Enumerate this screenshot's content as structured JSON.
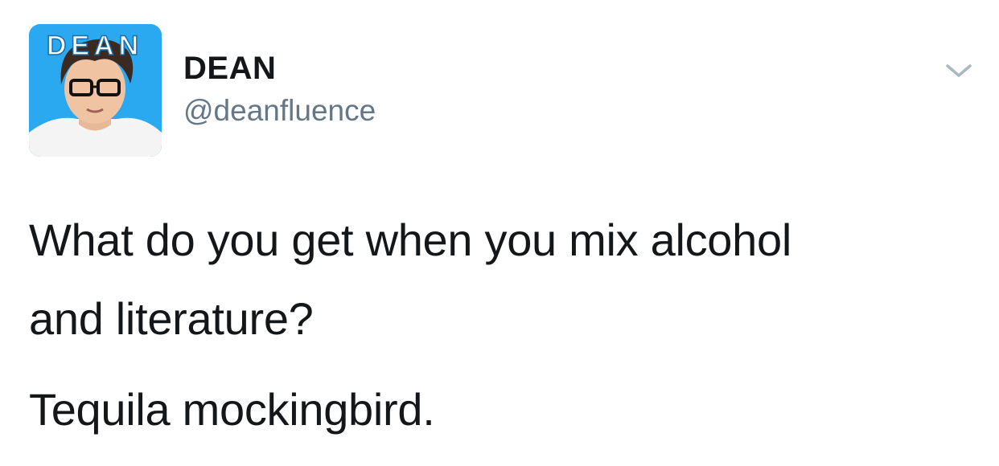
{
  "tweet": {
    "avatar": {
      "icon": "user-avatar-cartoon",
      "overlay_text": "DEAN",
      "background_color": "#2aa8f0"
    },
    "display_name": "DEAN",
    "handle": "@deanfluence",
    "menu_icon": "chevron-down-icon",
    "body_lines": [
      "What do you get when you mix alcohol",
      "and literature?",
      "Tequila mockingbird."
    ]
  },
  "colors": {
    "name": "#14171a",
    "handle": "#657786",
    "chevron": "#aab8c2",
    "body": "#14171a"
  }
}
